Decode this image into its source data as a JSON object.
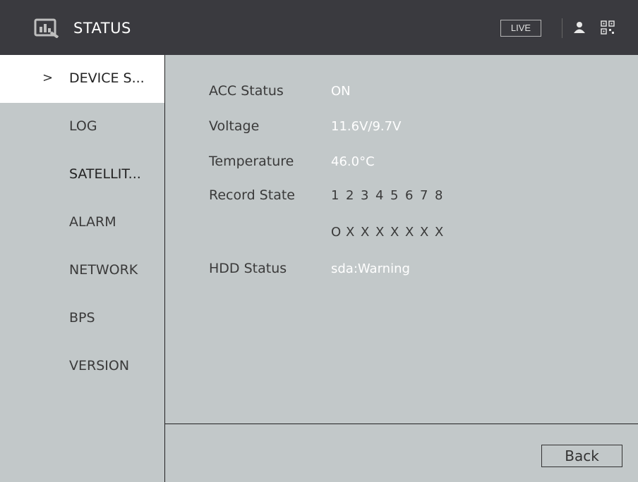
{
  "header": {
    "title": "STATUS",
    "live_label": "LIVE",
    "icons": [
      "logo-icon",
      "user-icon",
      "qr-code-icon"
    ]
  },
  "sidebar": {
    "items": [
      {
        "label": "DEVICE S...",
        "active": true
      },
      {
        "label": "LOG"
      },
      {
        "label": "SATELLIT..."
      },
      {
        "label": "ALARM"
      },
      {
        "label": "NETWORK"
      },
      {
        "label": "BPS"
      },
      {
        "label": "VERSION"
      }
    ],
    "active_marker": ">"
  },
  "status": {
    "acc_label": "ACC Status",
    "acc_value": "ON",
    "voltage_label": "Voltage",
    "voltage_value": "11.6V/9.7V",
    "temperature_label": "Temperature",
    "temperature_value": "46.0°C",
    "record_label": "Record State",
    "record_channels": [
      "1",
      "2",
      "3",
      "4",
      "5",
      "6",
      "7",
      "8"
    ],
    "record_states": [
      "O",
      "X",
      "X",
      "X",
      "X",
      "X",
      "X",
      "X"
    ],
    "hdd_label": "HDD Status",
    "hdd_value": "sda:Warning"
  },
  "footer": {
    "back_label": "Back"
  },
  "colors": {
    "topbar": "#3a3a3f",
    "background": "#c2c8c9",
    "value_text": "#ffffff",
    "active_item": "#ffffff"
  }
}
